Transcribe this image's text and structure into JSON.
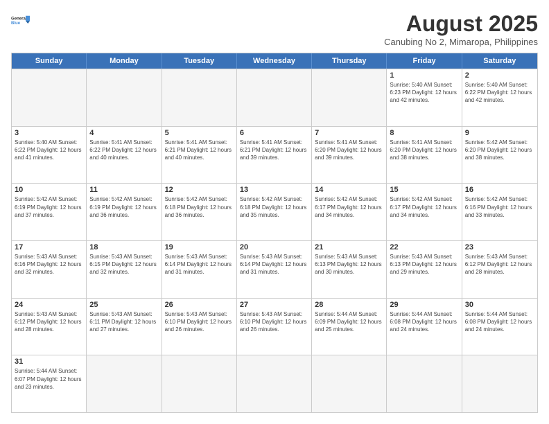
{
  "header": {
    "logo_general": "General",
    "logo_blue": "Blue",
    "month_title": "August 2025",
    "subtitle": "Canubing No 2, Mimaropa, Philippines"
  },
  "days_of_week": [
    "Sunday",
    "Monday",
    "Tuesday",
    "Wednesday",
    "Thursday",
    "Friday",
    "Saturday"
  ],
  "weeks": [
    [
      {
        "day": "",
        "info": ""
      },
      {
        "day": "",
        "info": ""
      },
      {
        "day": "",
        "info": ""
      },
      {
        "day": "",
        "info": ""
      },
      {
        "day": "",
        "info": ""
      },
      {
        "day": "1",
        "info": "Sunrise: 5:40 AM\nSunset: 6:23 PM\nDaylight: 12 hours and 42 minutes."
      },
      {
        "day": "2",
        "info": "Sunrise: 5:40 AM\nSunset: 6:22 PM\nDaylight: 12 hours and 42 minutes."
      }
    ],
    [
      {
        "day": "3",
        "info": "Sunrise: 5:40 AM\nSunset: 6:22 PM\nDaylight: 12 hours and 41 minutes."
      },
      {
        "day": "4",
        "info": "Sunrise: 5:41 AM\nSunset: 6:22 PM\nDaylight: 12 hours and 40 minutes."
      },
      {
        "day": "5",
        "info": "Sunrise: 5:41 AM\nSunset: 6:21 PM\nDaylight: 12 hours and 40 minutes."
      },
      {
        "day": "6",
        "info": "Sunrise: 5:41 AM\nSunset: 6:21 PM\nDaylight: 12 hours and 39 minutes."
      },
      {
        "day": "7",
        "info": "Sunrise: 5:41 AM\nSunset: 6:20 PM\nDaylight: 12 hours and 39 minutes."
      },
      {
        "day": "8",
        "info": "Sunrise: 5:41 AM\nSunset: 6:20 PM\nDaylight: 12 hours and 38 minutes."
      },
      {
        "day": "9",
        "info": "Sunrise: 5:42 AM\nSunset: 6:20 PM\nDaylight: 12 hours and 38 minutes."
      }
    ],
    [
      {
        "day": "10",
        "info": "Sunrise: 5:42 AM\nSunset: 6:19 PM\nDaylight: 12 hours and 37 minutes."
      },
      {
        "day": "11",
        "info": "Sunrise: 5:42 AM\nSunset: 6:19 PM\nDaylight: 12 hours and 36 minutes."
      },
      {
        "day": "12",
        "info": "Sunrise: 5:42 AM\nSunset: 6:18 PM\nDaylight: 12 hours and 36 minutes."
      },
      {
        "day": "13",
        "info": "Sunrise: 5:42 AM\nSunset: 6:18 PM\nDaylight: 12 hours and 35 minutes."
      },
      {
        "day": "14",
        "info": "Sunrise: 5:42 AM\nSunset: 6:17 PM\nDaylight: 12 hours and 34 minutes."
      },
      {
        "day": "15",
        "info": "Sunrise: 5:42 AM\nSunset: 6:17 PM\nDaylight: 12 hours and 34 minutes."
      },
      {
        "day": "16",
        "info": "Sunrise: 5:42 AM\nSunset: 6:16 PM\nDaylight: 12 hours and 33 minutes."
      }
    ],
    [
      {
        "day": "17",
        "info": "Sunrise: 5:43 AM\nSunset: 6:16 PM\nDaylight: 12 hours and 32 minutes."
      },
      {
        "day": "18",
        "info": "Sunrise: 5:43 AM\nSunset: 6:15 PM\nDaylight: 12 hours and 32 minutes."
      },
      {
        "day": "19",
        "info": "Sunrise: 5:43 AM\nSunset: 6:14 PM\nDaylight: 12 hours and 31 minutes."
      },
      {
        "day": "20",
        "info": "Sunrise: 5:43 AM\nSunset: 6:14 PM\nDaylight: 12 hours and 31 minutes."
      },
      {
        "day": "21",
        "info": "Sunrise: 5:43 AM\nSunset: 6:13 PM\nDaylight: 12 hours and 30 minutes."
      },
      {
        "day": "22",
        "info": "Sunrise: 5:43 AM\nSunset: 6:13 PM\nDaylight: 12 hours and 29 minutes."
      },
      {
        "day": "23",
        "info": "Sunrise: 5:43 AM\nSunset: 6:12 PM\nDaylight: 12 hours and 28 minutes."
      }
    ],
    [
      {
        "day": "24",
        "info": "Sunrise: 5:43 AM\nSunset: 6:12 PM\nDaylight: 12 hours and 28 minutes."
      },
      {
        "day": "25",
        "info": "Sunrise: 5:43 AM\nSunset: 6:11 PM\nDaylight: 12 hours and 27 minutes."
      },
      {
        "day": "26",
        "info": "Sunrise: 5:43 AM\nSunset: 6:10 PM\nDaylight: 12 hours and 26 minutes."
      },
      {
        "day": "27",
        "info": "Sunrise: 5:43 AM\nSunset: 6:10 PM\nDaylight: 12 hours and 26 minutes."
      },
      {
        "day": "28",
        "info": "Sunrise: 5:44 AM\nSunset: 6:09 PM\nDaylight: 12 hours and 25 minutes."
      },
      {
        "day": "29",
        "info": "Sunrise: 5:44 AM\nSunset: 6:08 PM\nDaylight: 12 hours and 24 minutes."
      },
      {
        "day": "30",
        "info": "Sunrise: 5:44 AM\nSunset: 6:08 PM\nDaylight: 12 hours and 24 minutes."
      }
    ],
    [
      {
        "day": "31",
        "info": "Sunrise: 5:44 AM\nSunset: 6:07 PM\nDaylight: 12 hours and 23 minutes."
      },
      {
        "day": "",
        "info": ""
      },
      {
        "day": "",
        "info": ""
      },
      {
        "day": "",
        "info": ""
      },
      {
        "day": "",
        "info": ""
      },
      {
        "day": "",
        "info": ""
      },
      {
        "day": "",
        "info": ""
      }
    ]
  ]
}
